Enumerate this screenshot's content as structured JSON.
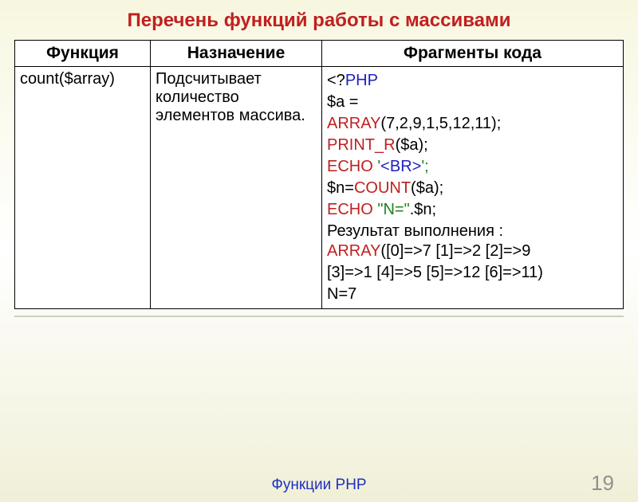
{
  "title": "Перечень функций работы с массивами",
  "headers": {
    "func": "Функция",
    "purpose": "Назначение",
    "code": "Фрагменты кода"
  },
  "row": {
    "func": "count($array)",
    "purpose": "Подсчитывает количество элементов массива.",
    "code": {
      "l1a": "<?",
      "l1b": "PHP",
      "l2a": "$a =",
      "l3a": "ARRAY",
      "l3b": "(7,2,9,1,5,12,11);",
      "l4a": "PRINT_R",
      "l4b": "($a);",
      "l5a": "ECHO",
      "l5b": " '",
      "l5c": "<BR>",
      "l5d": "';",
      "l6a": "$n=",
      "l6b": "COUNT",
      "l6c": "($a);",
      "l7a": "ECHO",
      "l7b": " \"N=\"",
      "l7c": ".$n;"
    },
    "result_label": "Результат выполнения :",
    "result": {
      "r1a": "ARRAY",
      "r1b": "([0]=>7 [1]=>2 [2]=>9",
      "r2": "[3]=>1 [4]=>5 [5]=>12 [6]=>11)",
      "r3": "N=7"
    }
  },
  "footer": "Функции PHP",
  "page": "19"
}
